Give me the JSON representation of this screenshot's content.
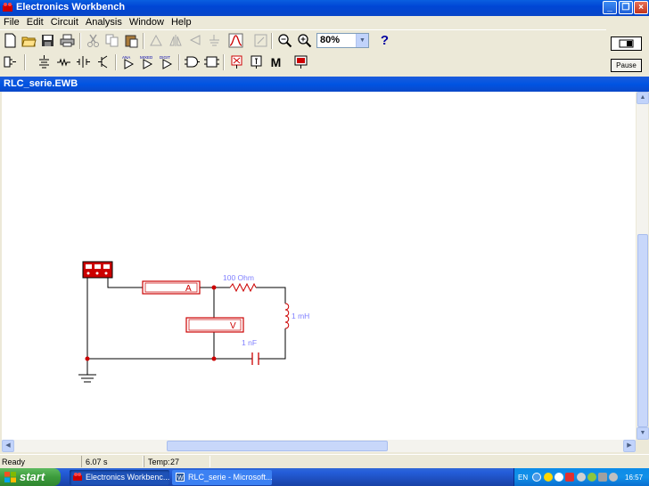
{
  "window": {
    "title": "Electronics Workbench"
  },
  "menu": [
    "File",
    "Edit",
    "Circuit",
    "Analysis",
    "Window",
    "Help"
  ],
  "toolbar": {
    "zoom_value": "80%",
    "help_label": "?",
    "misc_label": "M",
    "analog_label": "ANA",
    "mixed_label": "MIXED",
    "digital_label": "DIGIT"
  },
  "side": {
    "pause_label": "Pause"
  },
  "document": {
    "title": "RLC_serie.EWB"
  },
  "circuit": {
    "ammeter_label": "A",
    "voltmeter_label": "V",
    "resistor_label": "100  Ohm",
    "inductor_label": "1 mH",
    "capacitor_label": "1 nF"
  },
  "status": {
    "state": "Ready",
    "time": "6.07 s",
    "temp_label": "Temp:",
    "temp_value": "27"
  },
  "taskbar": {
    "start_label": "start",
    "tasks": [
      {
        "label": "Electronics Workbenc..."
      },
      {
        "label": "RLC_serie - Microsoft..."
      }
    ],
    "tray": {
      "lang": "EN",
      "clock": "16:57"
    }
  },
  "colors": {
    "titlebar": "#0054E3",
    "circuit_red": "#CC0000",
    "wire": "#000000",
    "label_blue": "#7F7FFF",
    "canvas": "#FFFFFF"
  }
}
